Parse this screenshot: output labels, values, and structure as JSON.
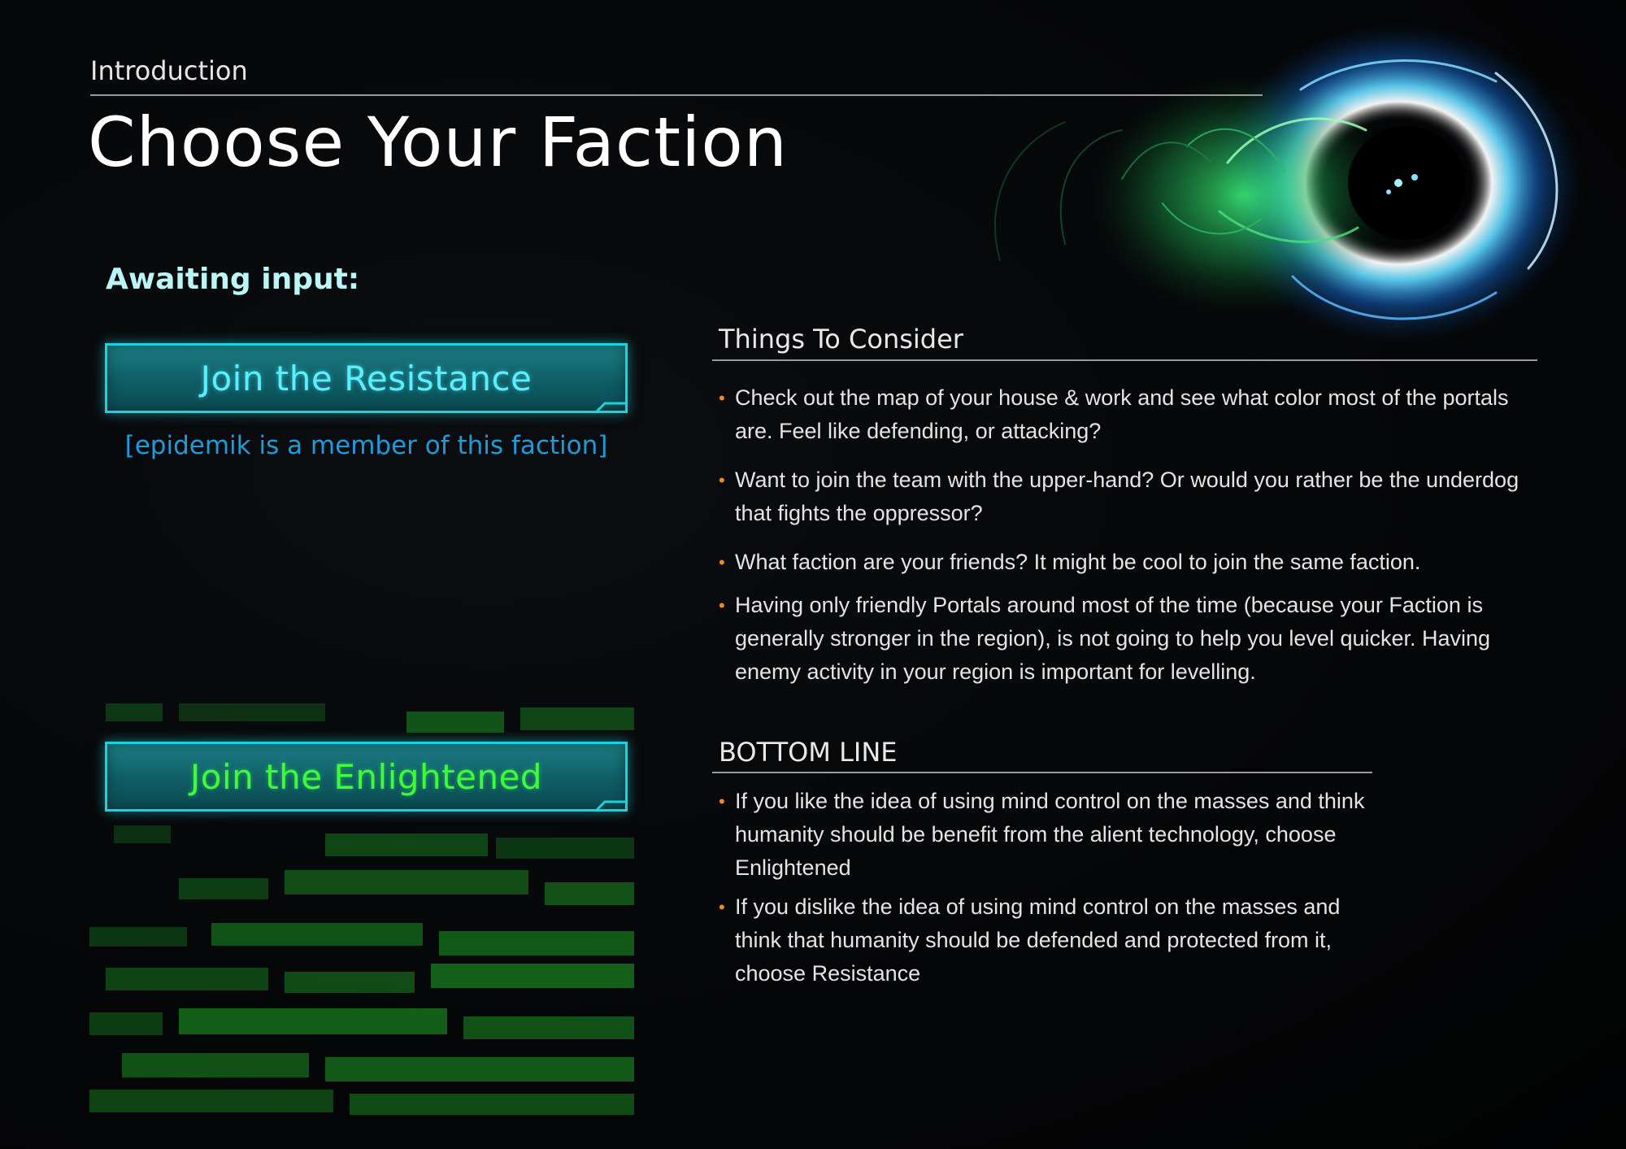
{
  "header": {
    "section": "Introduction",
    "title": "Choose Your Faction"
  },
  "selection": {
    "prompt": "Awaiting input:",
    "resistance_button": "Join the Resistance",
    "member_note": "[epidemik is a member of this faction]",
    "enlightened_button": "Join the Enlightened"
  },
  "consider": {
    "heading": "Things To Consider",
    "items": [
      "Check out the map of your house & work and see what color most of the portals are. Feel like defending, or attacking?",
      "Want to join the team with the upper-hand? Or would you rather be the underdog that fights the oppressor?",
      "What faction are your friends? It might be cool to join the same faction.",
      "Having only friendly Portals around most of the time (because your Faction is generally stronger in the region), is not going to help you level quicker. Having enemy activity in your region is important for levelling."
    ]
  },
  "bottom_line": {
    "heading": "BOTTOM LINE",
    "items": [
      "If you like the idea of using mind control on the masses and think humanity should be benefit from the alient technology, choose Enlightened",
      "If you dislike the idea of using mind control on the masses and think that humanity should be defended and protected from it, choose Resistance"
    ]
  },
  "colors": {
    "resistance": "#59efff",
    "enlightened": "#3dfc3a",
    "member_note": "#1e9bdb",
    "bullet": "#f08a1a",
    "button_border": "#1ed2dd"
  },
  "icons": {
    "portal": "portal-swirl-art",
    "bullet": "bullet-dot"
  }
}
